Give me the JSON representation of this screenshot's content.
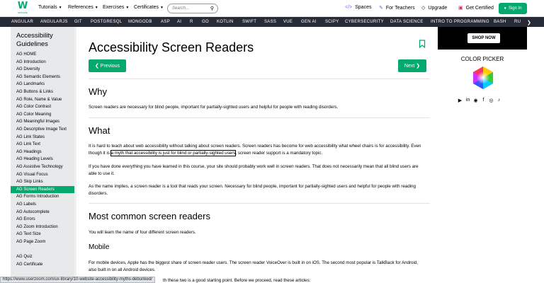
{
  "topbar": {
    "logo_letter": "W",
    "logo_sub": "schools",
    "nav": [
      {
        "label": "Tutorials"
      },
      {
        "label": "References"
      },
      {
        "label": "Exercises"
      },
      {
        "label": "Certificates"
      }
    ],
    "search_placeholder": "Search...",
    "right_links": [
      {
        "label": "Spaces"
      },
      {
        "label": "For Teachers"
      },
      {
        "label": "Upgrade"
      },
      {
        "label": "Get Certified"
      }
    ],
    "signin_label": "Sign In"
  },
  "darknav": [
    "ANGULAR",
    "ANGULARJS",
    "GIT",
    "POSTGRESQL",
    "MONGODB",
    "ASP",
    "AI",
    "R",
    "GO",
    "KOTLIN",
    "SWIFT",
    "SASS",
    "VUE",
    "GEN AI",
    "SCIPY",
    "CYBERSECURITY",
    "DATA SCIENCE",
    "INTRO TO PROGRAMMING",
    "BASH",
    "RU"
  ],
  "sidebar": {
    "heading": "Accessibility Guidelines",
    "items": [
      "AG HOME",
      "AG Introduction",
      "AG Diversity",
      "AG Semantic Elements",
      "AG Landmarks",
      "AG Buttons & Links",
      "AG Role, Name & Value",
      "AG Color Contrast",
      "AG Color Meaning",
      "AG Meaningful Images",
      "AG Descriptive Image Text",
      "AG Link States",
      "AG Link Text",
      "AG Headings",
      "AG Heading Levels",
      "AG Assistive Technology",
      "AG Visual Focus",
      "AG Skip Links",
      "AG Screen Readers",
      "AG Forms Introduction",
      "AG Labels",
      "AG Autocomplete",
      "AG Errors",
      "AG Zoom Introduction",
      "AG Text Size",
      "AG Page Zoom"
    ],
    "items2": [
      "AG Quiz",
      "AG Certificate"
    ],
    "active_index": 18
  },
  "main": {
    "title": "Accessibility Screen Readers",
    "prev_label": "❮ Previous",
    "next_label": "Next ❯",
    "why_heading": "Why",
    "why_text": "Screen readers are necessary for blind people, important for partially-sighted users and helpful for people with reading disorders.",
    "what_heading": "What",
    "what_p1_a": "It is hard to teach about web accessibility without talking about screen readers. Screen readers has become for web accessibility what wheel chairs is for accessibility. Even though it is ",
    "what_p1_link": "a myth that accessibility is just for blind or partially-sighted users",
    "what_p1_b": ", screen reader support is a mandatory topic.",
    "what_p2": "If you have done everything you have learned in this course, your site should probably work well in screen readers. That does not necessarily mean that all blind users are able to use it.",
    "what_p3": "As the name implies, a screen reader is a tool that reads your screen. Necessary for blind people, important for partially-sighted users and helpful for people with reading disorders.",
    "common_heading": "Most common screen readers",
    "common_text": "You will learn the name of four different screen readers.",
    "mobile_heading": "Mobile",
    "mobile_text": "For mobile devices, Apple has the biggest share of screen reader users. The screen reader VoiceOver is built in on iOS. The second most popular is TalkBack for Android, also built in on all Android devices.",
    "bottom_partial": "th these two is a good starting point. Before we proceed, read these articles:"
  },
  "right": {
    "shop_now": "SHOP NOW",
    "color_picker": "COLOR PICKER",
    "social_icons": [
      "youtube-icon",
      "linkedin-icon",
      "discord-icon",
      "facebook-icon",
      "instagram-icon",
      "tiktok-icon"
    ]
  },
  "statusbar": {
    "url": "https://www.userzoom.com/ux-library/10-website-accessibility-myths-debunked/"
  },
  "colors": {
    "accent": "#04AA6D",
    "dark_nav": "#282A35",
    "sidebar_bg": "#E7E9EB"
  }
}
